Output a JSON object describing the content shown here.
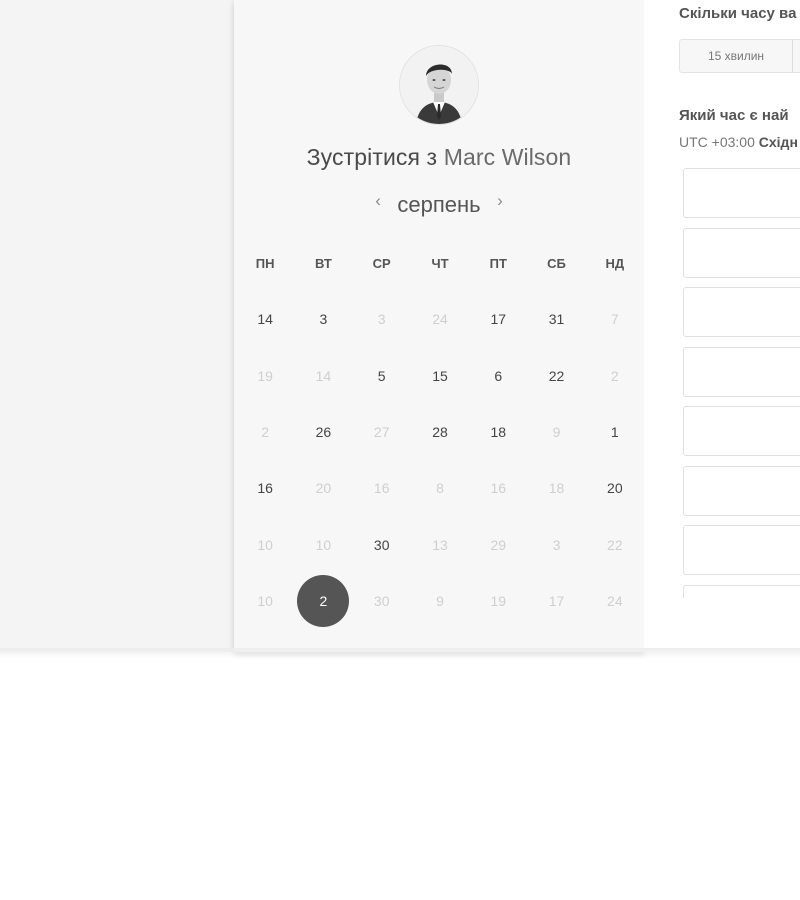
{
  "scheduler": {
    "title_prefix": "Зустрітися з",
    "host_name": "Marc Wilson",
    "month": "серпень",
    "prev_arrow": "‹",
    "next_arrow": "›",
    "weekdays": [
      "ПН",
      "ВТ",
      "СР",
      "ЧТ",
      "ПТ",
      "СБ",
      "НД"
    ],
    "weeks": [
      [
        {
          "d": "14",
          "a": true
        },
        {
          "d": "3",
          "a": true
        },
        {
          "d": "3",
          "a": false
        },
        {
          "d": "24",
          "a": false
        },
        {
          "d": "17",
          "a": true
        },
        {
          "d": "31",
          "a": true
        },
        {
          "d": "7",
          "a": false
        }
      ],
      [
        {
          "d": "19",
          "a": false
        },
        {
          "d": "14",
          "a": false
        },
        {
          "d": "5",
          "a": true
        },
        {
          "d": "15",
          "a": true
        },
        {
          "d": "6",
          "a": true
        },
        {
          "d": "22",
          "a": true
        },
        {
          "d": "2",
          "a": false
        }
      ],
      [
        {
          "d": "2",
          "a": false
        },
        {
          "d": "26",
          "a": true
        },
        {
          "d": "27",
          "a": false
        },
        {
          "d": "28",
          "a": true
        },
        {
          "d": "18",
          "a": true
        },
        {
          "d": "9",
          "a": false
        },
        {
          "d": "1",
          "a": true
        }
      ],
      [
        {
          "d": "16",
          "a": true
        },
        {
          "d": "20",
          "a": false
        },
        {
          "d": "16",
          "a": false
        },
        {
          "d": "8",
          "a": false
        },
        {
          "d": "16",
          "a": false
        },
        {
          "d": "18",
          "a": false
        },
        {
          "d": "20",
          "a": true
        }
      ],
      [
        {
          "d": "10",
          "a": false
        },
        {
          "d": "10",
          "a": false
        },
        {
          "d": "30",
          "a": true
        },
        {
          "d": "13",
          "a": false
        },
        {
          "d": "29",
          "a": false
        },
        {
          "d": "3",
          "a": false
        },
        {
          "d": "22",
          "a": false
        }
      ],
      [
        {
          "d": "10",
          "a": false
        },
        {
          "d": "2",
          "a": true,
          "sel": true
        },
        {
          "d": "30",
          "a": false
        },
        {
          "d": "9",
          "a": false
        },
        {
          "d": "19",
          "a": false
        },
        {
          "d": "17",
          "a": false
        },
        {
          "d": "24",
          "a": false
        }
      ]
    ]
  },
  "booking": {
    "duration_question": "Скільки часу ва",
    "duration_option": "15 хвилин",
    "time_question": "Який час є най",
    "timezone_offset": "UTC +03:00",
    "timezone_name": "Східн",
    "slot_count": 8
  },
  "colors": {
    "selected_day": "#555555",
    "active_day_text": "#444444",
    "inactive_day_text": "#cfcfcf"
  }
}
